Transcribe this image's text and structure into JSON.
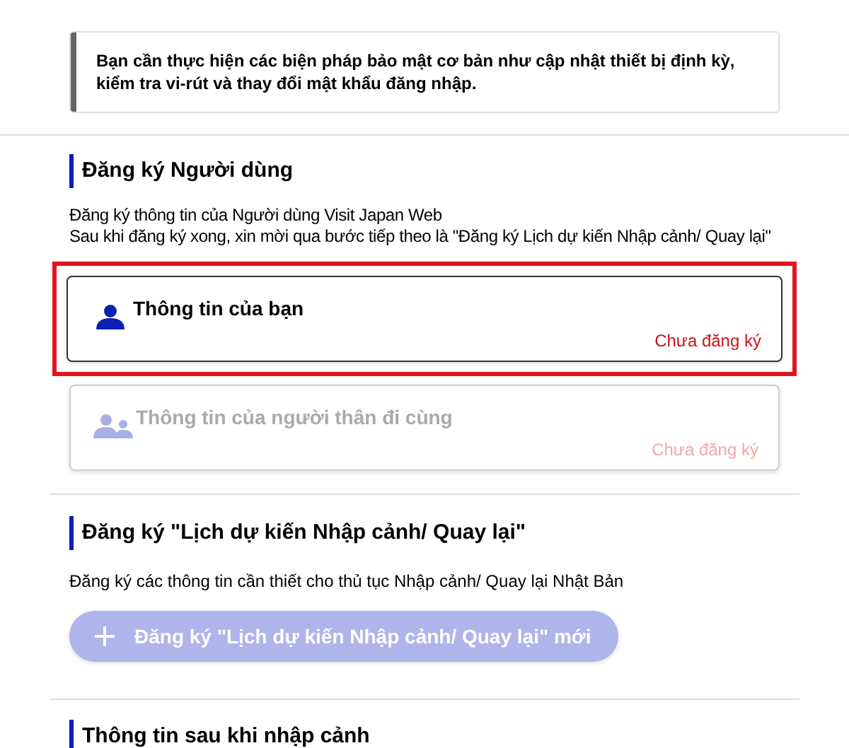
{
  "notice": {
    "text": "Bạn cần thực hiện các biện pháp bảo mật cơ bản như cập nhật thiết bị định kỳ, kiểm tra vi-rút và thay đổi mật khẩu đăng nhập."
  },
  "user_registration": {
    "heading": "Đăng ký Người dùng",
    "description": [
      "Đăng ký thông tin của Người dùng Visit Japan Web",
      "Sau khi đăng ký xong, xin mời qua bước tiếp theo là \"Đăng ký Lịch dự kiến Nhập cảnh/ Quay lại\""
    ],
    "cards": [
      {
        "kind": "single",
        "title": "Thông tin của bạn",
        "status": "Chưa đăng ký",
        "disabled": false,
        "highlighted": true
      },
      {
        "kind": "group",
        "title": "Thông tin của người thân đi cùng",
        "status": "Chưa đăng ký",
        "disabled": true,
        "highlighted": false
      }
    ]
  },
  "schedule_registration": {
    "heading": "Đăng ký \"Lịch dự kiến Nhập cảnh/ Quay lại\"",
    "description": "Đăng ký các thông tin cần thiết cho thủ tục Nhập cảnh/ Quay lại Nhật Bản",
    "button": {
      "label": "Đăng ký \"Lịch dự kiến Nhập cảnh/ Quay lại\" mới",
      "disabled": true
    }
  },
  "after_entry": {
    "heading": "Thông tin sau khi nhập cảnh"
  }
}
